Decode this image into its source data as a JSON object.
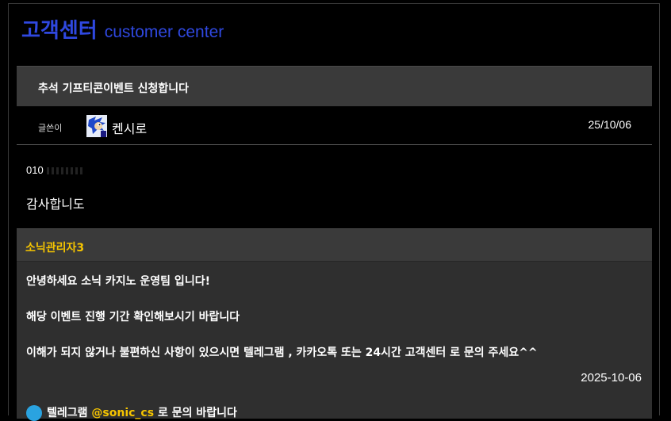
{
  "header": {
    "title_ko": "고객센터",
    "title_en": "customer center",
    "accent_color": "#2f48e0"
  },
  "post": {
    "title": "추석 기프티콘이벤트 신청합니다",
    "author_label": "글쓴이",
    "author": "켄시로",
    "date": "25/10/06",
    "phone_prefix": "010",
    "message": "감사합니도"
  },
  "reply": {
    "author": "소닉관리자3",
    "author_color": "#f5c400",
    "lines": [
      "안녕하세요 소닉 카지노 운영팀 입니다!",
      "해당 이벤트 진행 기간 확인해보시기 바랍니다",
      "이해가 되지 않거나 불편하신 사항이 있으시면 텔레그램 , 카카오톡 또는 24시간 고객센터 로 문의 주세요^^"
    ],
    "date": "2025-10-06",
    "contact_prefix": "텔레그램",
    "contact_handle": "@sonic_cs",
    "contact_suffix": "로 문의 바랍니다"
  }
}
